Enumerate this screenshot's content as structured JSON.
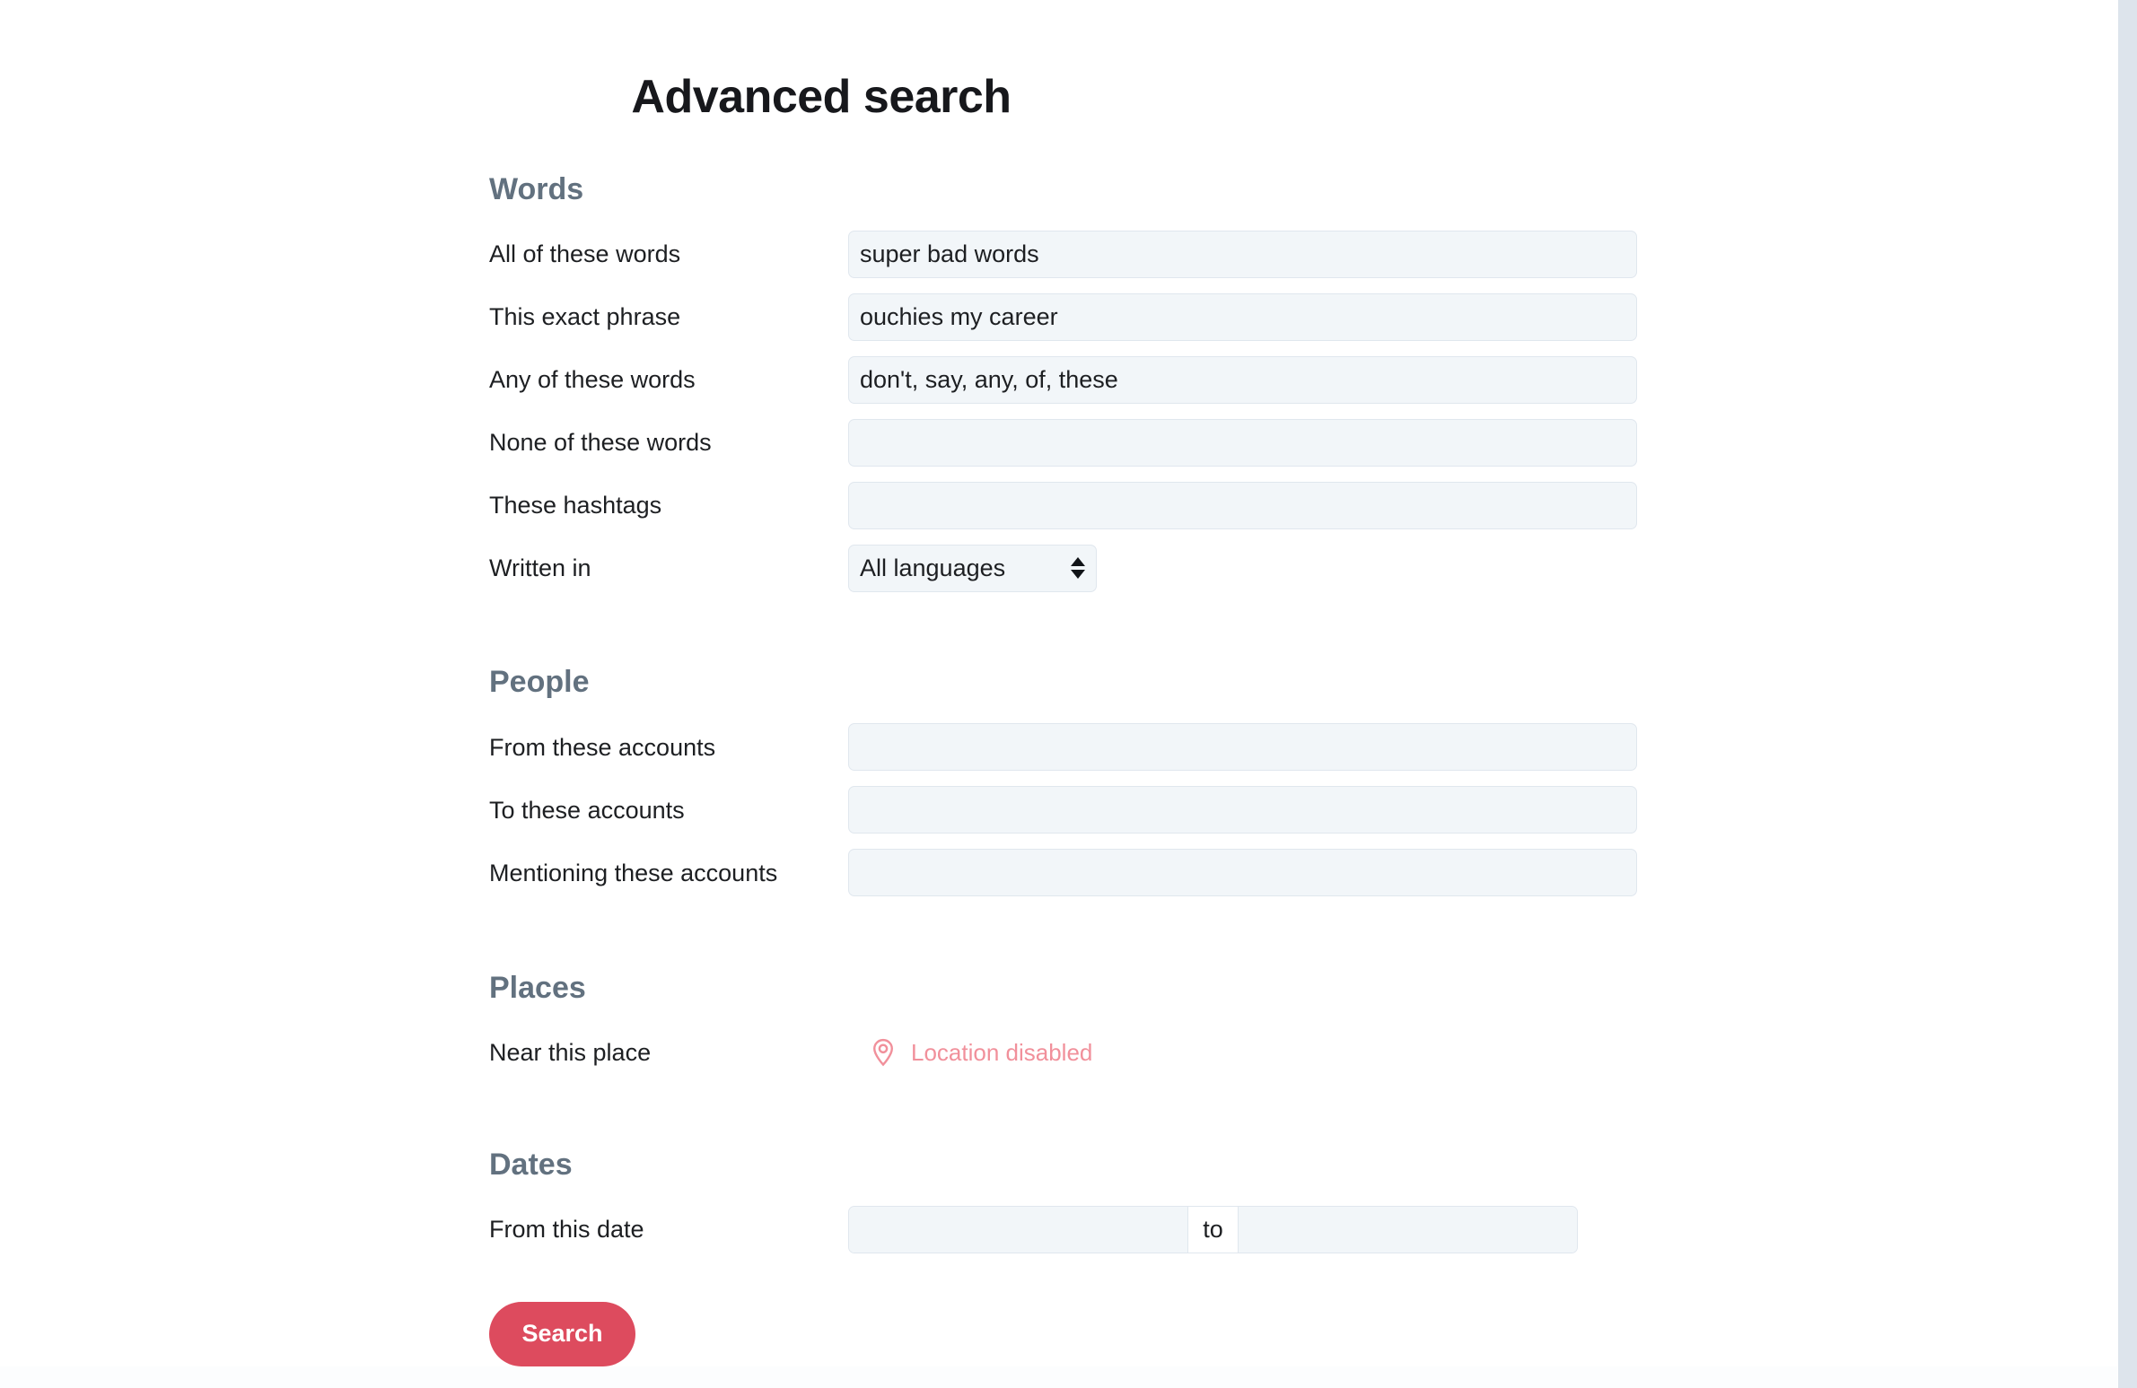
{
  "page": {
    "title": "Advanced search"
  },
  "sections": {
    "words": {
      "heading": "Words",
      "rows": [
        {
          "label": "All of these words",
          "value": "super bad words",
          "placeholder": ""
        },
        {
          "label": "This exact phrase",
          "value": "ouchies my career",
          "placeholder": ""
        },
        {
          "label": "Any of these words",
          "value": "don't, say, any, of, these",
          "placeholder": ""
        },
        {
          "label": "None of these words",
          "value": "",
          "placeholder": ""
        },
        {
          "label": "These hashtags",
          "value": "",
          "placeholder": ""
        }
      ],
      "language_row": {
        "label": "Written in",
        "selected": "All languages"
      }
    },
    "people": {
      "heading": "People",
      "rows": [
        {
          "label": "From these accounts",
          "value": "",
          "placeholder": ""
        },
        {
          "label": "To these accounts",
          "value": "",
          "placeholder": ""
        },
        {
          "label": "Mentioning these accounts",
          "value": "",
          "placeholder": ""
        }
      ]
    },
    "places": {
      "heading": "Places",
      "row": {
        "label": "Near this place",
        "status_text": "Location disabled",
        "icon": "map-pin-icon",
        "status_color": "#f1909b"
      }
    },
    "dates": {
      "heading": "Dates",
      "row": {
        "label": "From this date",
        "from_value": "",
        "from_placeholder": "",
        "separator": "to",
        "to_value": "",
        "to_placeholder": ""
      }
    }
  },
  "actions": {
    "search_label": "Search",
    "search_color": "#dd4b5e"
  },
  "theme": {
    "heading_color": "#62717f",
    "label_color": "#1d1f22",
    "input_bg": "#f2f6f9",
    "input_border": "#e0e7ee",
    "title_color": "#17181c",
    "scrollbar_track": "#dde4ec"
  }
}
